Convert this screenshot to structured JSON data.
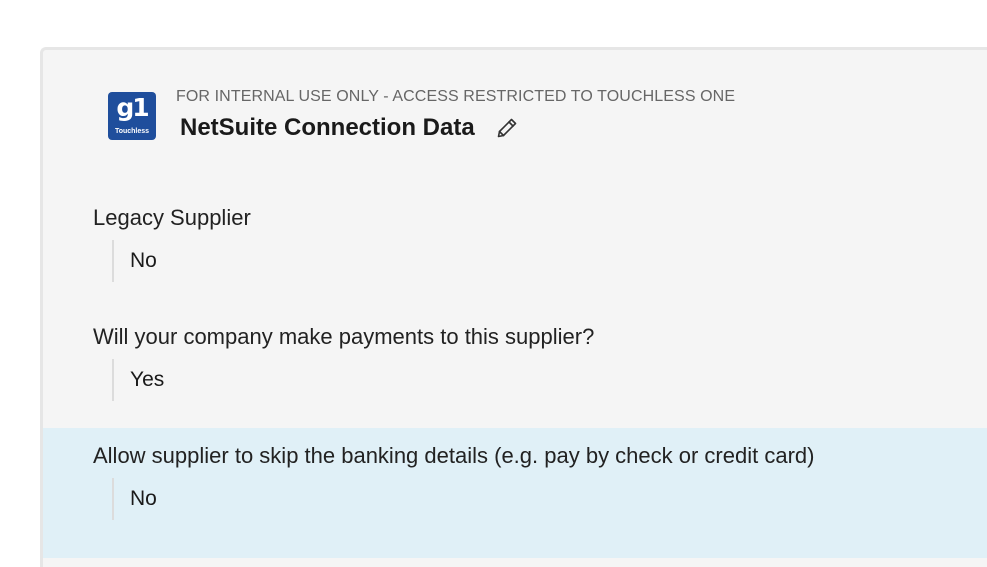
{
  "header": {
    "logo_text": "g1",
    "logo_subtext": "Touchless",
    "eyebrow": "FOR INTERNAL USE ONLY - ACCESS RESTRICTED TO TOUCHLESS ONE",
    "title": "NetSuite Connection Data",
    "edit_icon": "pencil-icon"
  },
  "fields": [
    {
      "label": "Legacy Supplier",
      "value": "No"
    },
    {
      "label": "Will your company make payments to this supplier?",
      "value": "Yes"
    },
    {
      "label": "Allow supplier to skip the banking details (e.g. pay by check or credit card)",
      "value": "No"
    }
  ],
  "colors": {
    "card_background": "#f5f5f5",
    "highlight_background": "#e0f0f7",
    "logo_blue": "#1f4e9c"
  }
}
